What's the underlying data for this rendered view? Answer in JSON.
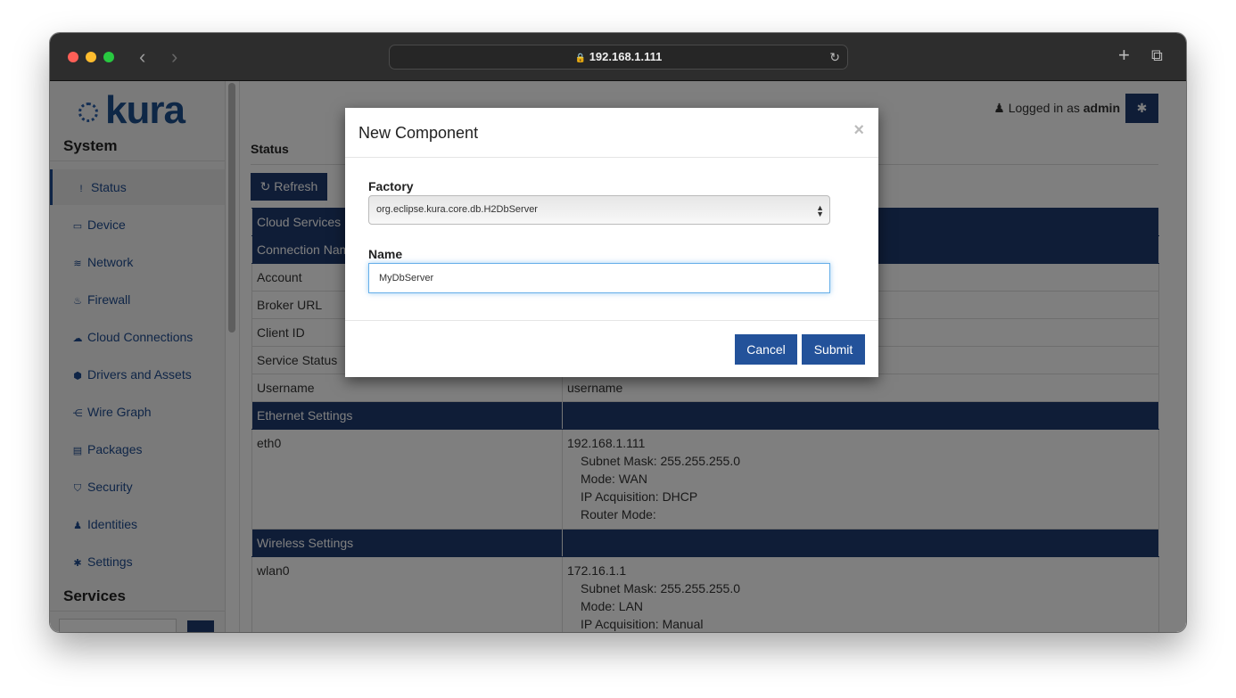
{
  "browser": {
    "url": "192.168.1.111",
    "back": "‹",
    "forward": "›",
    "new_tab": "+",
    "tabs_icon": "⧉",
    "reload": "↻",
    "lock": "🔒"
  },
  "colors": {
    "accent": "#1f3a6e",
    "link": "#1e4b8f",
    "button": "#23529a"
  },
  "logo": "kura",
  "sidebar": {
    "system_title": "System",
    "items": [
      {
        "label": "Status",
        "icon": "!"
      },
      {
        "label": "Device",
        "icon": "▭"
      },
      {
        "label": "Network",
        "icon": "≋"
      },
      {
        "label": "Firewall",
        "icon": "♨"
      },
      {
        "label": "Cloud Connections",
        "icon": "☁"
      },
      {
        "label": "Drivers and Assets",
        "icon": "⬢"
      },
      {
        "label": "Wire Graph",
        "icon": "⋲"
      },
      {
        "label": "Packages",
        "icon": "▤"
      },
      {
        "label": "Security",
        "icon": "⛉"
      },
      {
        "label": "Identities",
        "icon": "♟"
      },
      {
        "label": "Settings",
        "icon": "✱"
      }
    ],
    "services_title": "Services"
  },
  "header": {
    "logged_prefix": "Logged in as",
    "user": "admin",
    "user_icon": "♟",
    "gear_icon": "✱"
  },
  "main": {
    "title": "Status",
    "refresh": "↻ Refresh",
    "rows": [
      {
        "type": "header",
        "label": "Cloud Services",
        "value": ""
      },
      {
        "type": "header",
        "label": "Connection Name",
        "value": ""
      },
      {
        "label": "Account",
        "value": ""
      },
      {
        "label": "Broker URL",
        "value": ""
      },
      {
        "label": "Client ID",
        "value": ""
      },
      {
        "label": "Service Status",
        "value": ""
      },
      {
        "label": "Username",
        "value": "username"
      },
      {
        "type": "header",
        "label": "Ethernet Settings",
        "value": ""
      },
      {
        "label": "eth0",
        "value": "192.168.1.111",
        "details": [
          "Subnet Mask: 255.255.255.0",
          "Mode: WAN",
          "IP Acquisition: DHCP",
          "Router Mode:"
        ]
      },
      {
        "type": "header",
        "label": "Wireless Settings",
        "value": ""
      },
      {
        "label": "wlan0",
        "value": "172.16.1.1",
        "details": [
          "Subnet Mask: 255.255.255.0",
          "Mode: LAN",
          "IP Acquisition: Manual"
        ]
      }
    ]
  },
  "modal": {
    "title": "New Component",
    "close": "×",
    "factory_label": "Factory",
    "factory_value": "org.eclipse.kura.core.db.H2DbServer",
    "name_label": "Name",
    "name_value": "MyDbServer",
    "cancel": "Cancel",
    "submit": "Submit"
  }
}
